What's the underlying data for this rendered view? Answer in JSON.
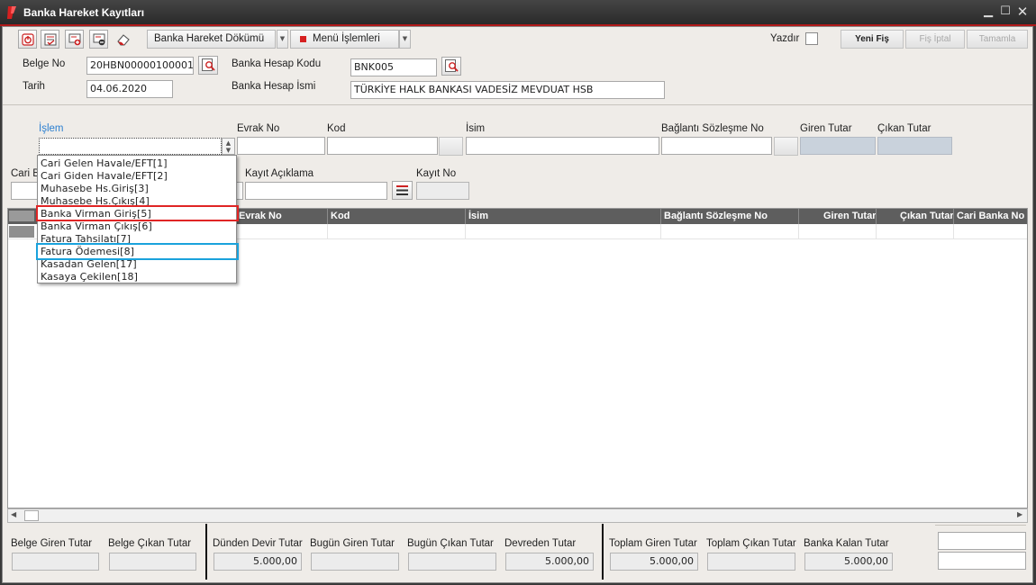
{
  "window": {
    "title": "Banka Hareket Kayıtları"
  },
  "colors": {
    "accent_red": "#d62020",
    "highlight_blue": "#1aa2dc",
    "grid_header": "#5e5e5e"
  },
  "toolbar": {
    "icons": [
      "power-icon",
      "checklist-icon",
      "add-record-icon",
      "remove-record-icon",
      "eraser-icon"
    ],
    "report_label": "Banka Hareket Dökümü",
    "menu_label": "Menü İşlemleri",
    "print_label": "Yazdır",
    "new_label": "Yeni Fiş",
    "cancel_label": "Fiş İptal",
    "complete_label": "Tamamla"
  },
  "header": {
    "belge_no_label": "Belge No",
    "belge_no_value": "20HBN00000100001",
    "tarih_label": "Tarih",
    "tarih_value": "04.06.2020",
    "hesap_kodu_label": "Banka Hesap Kodu",
    "hesap_kodu_value": "BNK005",
    "hesap_ismi_label": "Banka Hesap İsmi",
    "hesap_ismi_value": "TÜRKİYE HALK BANKASI VADESİZ MEVDUAT HSB"
  },
  "entry": {
    "islem_label": "İşlem",
    "evrak_label": "Evrak No",
    "kod_label": "Kod",
    "isim_label": "İsim",
    "baglanti_label": "Bağlantı Sözleşme No",
    "giren_label": "Giren Tutar",
    "cikan_label": "Çıkan Tutar",
    "cari_label": "Cari B",
    "aciklama_label": "Kayıt Açıklama",
    "kayit_no_label": "Kayıt No"
  },
  "dropdown": {
    "items": [
      "Cari Gelen Havale/EFT[1]",
      "Cari Giden Havale/EFT[2]",
      "Muhasebe Hs.Giriş[3]",
      "Muhasebe Hs.Çıkış[4]",
      "Banka Virman Giriş[5]",
      "Banka Virman Çıkış[6]",
      "Fatura Tahsilatı[7]",
      "Fatura Ödemesi[8]",
      "Kasadan Gelen[17]",
      "Kasaya Çekilen[18]"
    ],
    "highlight_red_index": 4,
    "highlight_blue_index": 7
  },
  "grid": {
    "columns": [
      "Evrak No",
      "Kod",
      "İsim",
      "Bağlantı Sözleşme No",
      "Giren Tutar",
      "Çıkan Tutar",
      "Cari Banka No"
    ]
  },
  "footer": {
    "belge_giren_label": "Belge Giren Tutar",
    "belge_cikan_label": "Belge Çıkan Tutar",
    "dunden_label": "Dünden Devir Tutar",
    "dunden_value": "5.000,00",
    "bugun_giren_label": "Bugün Giren Tutar",
    "bugun_cikan_label": "Bugün Çıkan Tutar",
    "devreden_label": "Devreden Tutar",
    "devreden_value": "5.000,00",
    "toplam_giren_label": "Toplam Giren Tutar",
    "toplam_giren_value": "5.000,00",
    "toplam_cikan_label": "Toplam Çıkan Tutar",
    "kalan_label": "Banka Kalan Tutar",
    "kalan_value": "5.000,00"
  }
}
